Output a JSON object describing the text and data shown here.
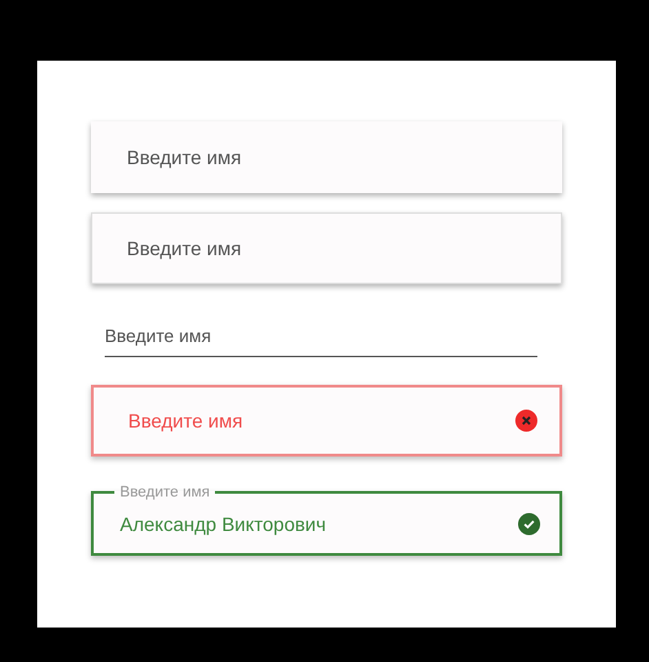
{
  "fields": [
    {
      "kind": "shadow",
      "placeholder": "Введите имя"
    },
    {
      "kind": "outlined",
      "placeholder": "Введите имя"
    },
    {
      "kind": "underline",
      "placeholder": "Введите имя"
    },
    {
      "kind": "error",
      "placeholder": "Введите имя"
    },
    {
      "kind": "success",
      "label": "Введите имя",
      "value": "Александр Викторович"
    }
  ]
}
